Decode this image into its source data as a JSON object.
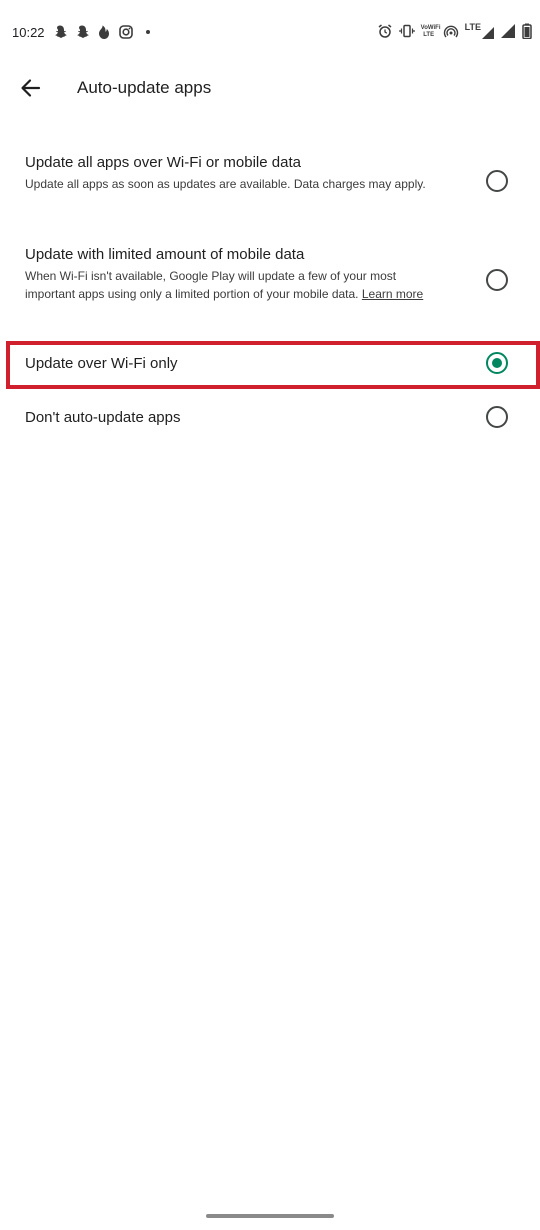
{
  "status_bar": {
    "time": "10:22",
    "left_icons": [
      "snapchat-icon",
      "snapchat-icon",
      "tinder-icon",
      "instagram-icon",
      "dot-icon"
    ],
    "right_icons": [
      "alarm-icon",
      "vibrate-icon",
      "volte-icon",
      "hotspot-icon",
      "lte-signal-icon",
      "signal-icon",
      "battery-icon"
    ],
    "network_label": "LTE",
    "volte_top": "VoWiFi",
    "volte_bottom": "LTE"
  },
  "toolbar": {
    "back_icon": "arrow-back-icon",
    "title": "Auto-update apps"
  },
  "options": [
    {
      "title": "Update all apps over Wi-Fi or mobile data",
      "desc": "Update all apps as soon as updates are available. Data charges may apply.",
      "selected": false
    },
    {
      "title": "Update with limited amount of mobile data",
      "desc": "When Wi-Fi isn't available, Google Play will update a few of your most important apps using only a limited portion of your mobile data.",
      "link": "Learn more",
      "selected": false
    },
    {
      "title": "Update over Wi-Fi only",
      "selected": true
    },
    {
      "title": "Don't auto-update apps",
      "selected": false
    }
  ],
  "colors": {
    "accent": "#01875f",
    "highlight": "#d0202e",
    "text_primary": "#1f1f1f",
    "text_secondary": "#3c3c3c"
  }
}
